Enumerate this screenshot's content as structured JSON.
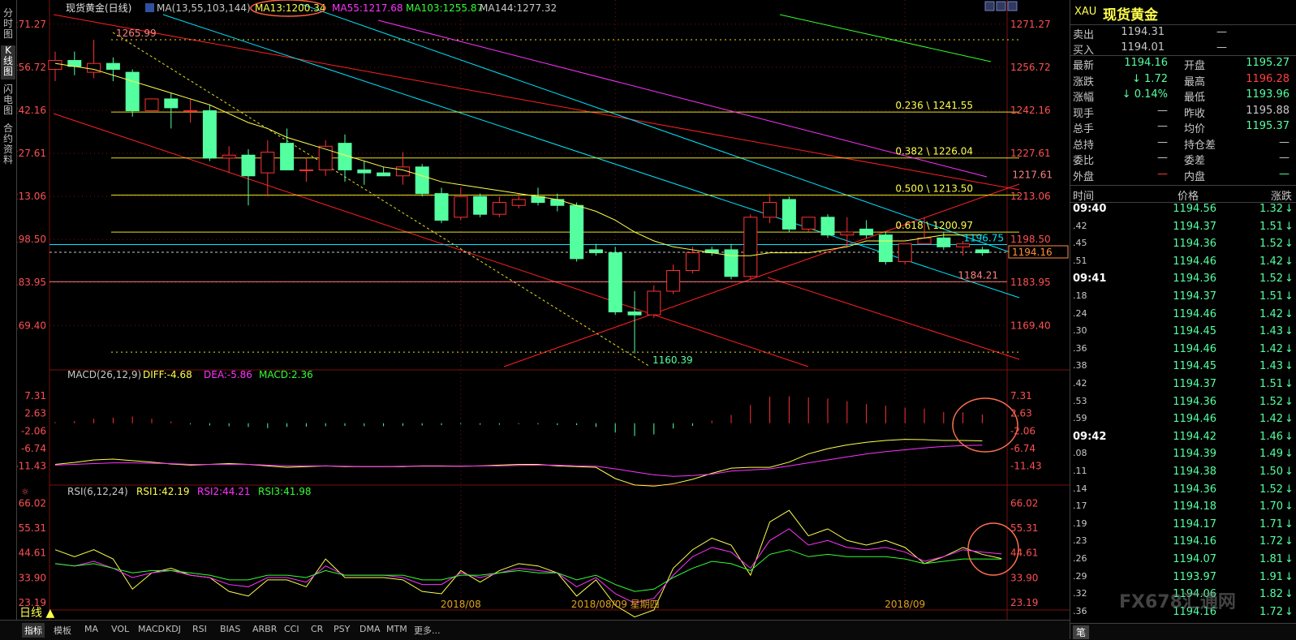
{
  "sidebar": {
    "tabs": [
      "分时图",
      "K线图",
      "闪电图",
      "合约资料"
    ]
  },
  "header": {
    "name": "现货黄金(日线)",
    "ma_label": "MA(13,55,103,144)",
    "ma13": "MA13:1200.34",
    "ma55": "MA55:1217.68",
    "ma103": "MA103:1255.87",
    "ma144": "MA144:1277.32"
  },
  "macd_header": {
    "label": "MACD(26,12,9)",
    "diff": "DIFF:-4.68",
    "dea": "DEA:-5.86",
    "macd": "MACD:2.36"
  },
  "rsi_header": {
    "label": "RSI(6,12,24)",
    "rsi1": "RSI1:42.19",
    "rsi2": "RSI2:44.21",
    "rsi3": "RSI3:41.98"
  },
  "colors": {
    "up": "#ff3232",
    "down": "#54ffa0",
    "ma13": "#ffff4c",
    "ma55": "#ff32ff",
    "ma103": "#32ff32",
    "ma144": "#c8c8c8",
    "cyan": "#00e5ff",
    "red_line": "#ff2020",
    "grid": "#7a1010",
    "axis": "#ff5050",
    "fib": "#e8e020"
  },
  "chart_data": [
    {
      "type": "candlestick",
      "title": "现货黄金(日线)",
      "price_axis_ticks": [
        "1271.27",
        "1256.72",
        "1242.16",
        "1227.61",
        "1213.06",
        "1198.50",
        "1183.95",
        "1169.40"
      ],
      "ylim": [
        1155.5,
        1274.5
      ],
      "x_labels": [
        {
          "i": 21,
          "label": "2018/08"
        },
        {
          "i": 29,
          "label": "2018/08/09 星期四"
        },
        {
          "i": 44,
          "label": "2018/09"
        }
      ],
      "candles": [
        {
          "o": 1256,
          "h": 1262,
          "l": 1252,
          "c": 1259
        },
        {
          "o": 1259,
          "h": 1262,
          "l": 1254,
          "c": 1257
        },
        {
          "o": 1255,
          "h": 1266,
          "l": 1253,
          "c": 1258
        },
        {
          "o": 1258,
          "h": 1260,
          "l": 1252,
          "c": 1256
        },
        {
          "o": 1255,
          "h": 1256,
          "l": 1240,
          "c": 1242
        },
        {
          "o": 1242,
          "h": 1246,
          "l": 1242,
          "c": 1246
        },
        {
          "o": 1246,
          "h": 1248,
          "l": 1236,
          "c": 1243
        },
        {
          "o": 1242,
          "h": 1246,
          "l": 1238,
          "c": 1242
        },
        {
          "o": 1242,
          "h": 1244,
          "l": 1225,
          "c": 1226
        },
        {
          "o": 1226,
          "h": 1230,
          "l": 1221,
          "c": 1227
        },
        {
          "o": 1227,
          "h": 1229,
          "l": 1210,
          "c": 1220
        },
        {
          "o": 1221,
          "h": 1232,
          "l": 1213,
          "c": 1228
        },
        {
          "o": 1231,
          "h": 1236,
          "l": 1223,
          "c": 1222
        },
        {
          "o": 1222,
          "h": 1226,
          "l": 1218,
          "c": 1222
        },
        {
          "o": 1222,
          "h": 1232,
          "l": 1220,
          "c": 1230
        },
        {
          "o": 1231,
          "h": 1234,
          "l": 1218,
          "c": 1222
        },
        {
          "o": 1222,
          "h": 1225,
          "l": 1217,
          "c": 1221
        },
        {
          "o": 1221,
          "h": 1223,
          "l": 1220,
          "c": 1220
        },
        {
          "o": 1220,
          "h": 1228,
          "l": 1217,
          "c": 1223
        },
        {
          "o": 1223,
          "h": 1224,
          "l": 1213,
          "c": 1214
        },
        {
          "o": 1214,
          "h": 1216,
          "l": 1204,
          "c": 1205
        },
        {
          "o": 1206,
          "h": 1216,
          "l": 1205,
          "c": 1213
        },
        {
          "o": 1213,
          "h": 1214,
          "l": 1206,
          "c": 1207
        },
        {
          "o": 1207,
          "h": 1213,
          "l": 1206,
          "c": 1211
        },
        {
          "o": 1210,
          "h": 1214,
          "l": 1209,
          "c": 1212
        },
        {
          "o": 1213,
          "h": 1216,
          "l": 1210,
          "c": 1211
        },
        {
          "o": 1212,
          "h": 1214,
          "l": 1208,
          "c": 1210
        },
        {
          "o": 1210,
          "h": 1211,
          "l": 1191,
          "c": 1192
        },
        {
          "o": 1195,
          "h": 1197,
          "l": 1193,
          "c": 1194
        },
        {
          "o": 1194,
          "h": 1196,
          "l": 1173,
          "c": 1174
        },
        {
          "o": 1174,
          "h": 1181,
          "l": 1160,
          "c": 1173
        },
        {
          "o": 1173,
          "h": 1183,
          "l": 1172,
          "c": 1181
        },
        {
          "o": 1181,
          "h": 1190,
          "l": 1180,
          "c": 1188
        },
        {
          "o": 1188,
          "h": 1196,
          "l": 1187,
          "c": 1194
        },
        {
          "o": 1195,
          "h": 1196,
          "l": 1193,
          "c": 1194
        },
        {
          "o": 1195,
          "h": 1197,
          "l": 1185,
          "c": 1186
        },
        {
          "o": 1186,
          "h": 1207,
          "l": 1185,
          "c": 1206
        },
        {
          "o": 1206,
          "h": 1214,
          "l": 1204,
          "c": 1211
        },
        {
          "o": 1212,
          "h": 1213,
          "l": 1201,
          "c": 1202
        },
        {
          "o": 1202,
          "h": 1206,
          "l": 1201,
          "c": 1206
        },
        {
          "o": 1206,
          "h": 1207,
          "l": 1199,
          "c": 1200
        },
        {
          "o": 1200,
          "h": 1206,
          "l": 1196,
          "c": 1201
        },
        {
          "o": 1202,
          "h": 1205,
          "l": 1199,
          "c": 1200
        },
        {
          "o": 1200,
          "h": 1201,
          "l": 1190,
          "c": 1191
        },
        {
          "o": 1191,
          "h": 1197,
          "l": 1190,
          "c": 1197
        },
        {
          "o": 1197,
          "h": 1206,
          "l": 1197,
          "c": 1199
        },
        {
          "o": 1199,
          "h": 1201,
          "l": 1195,
          "c": 1196
        },
        {
          "o": 1196,
          "h": 1198,
          "l": 1193,
          "c": 1197
        },
        {
          "o": 1195,
          "h": 1196,
          "l": 1193,
          "c": 1194
        }
      ],
      "ma13": [
        1258,
        1257,
        1256,
        1254,
        1252,
        1250,
        1248,
        1246,
        1244,
        1241,
        1238,
        1236,
        1233,
        1231,
        1229,
        1227,
        1225,
        1223,
        1222,
        1220,
        1218,
        1217,
        1216,
        1215,
        1214,
        1213,
        1212,
        1210,
        1208,
        1205,
        1201,
        1198,
        1196,
        1195,
        1194,
        1193,
        1193,
        1194,
        1194,
        1194,
        1195,
        1196,
        1198,
        1198,
        1198,
        1199,
        1200,
        1200,
        1200
      ],
      "ma55": [
        1236,
        1234,
        1232,
        1230,
        1228,
        1226,
        1224,
        1222,
        1220,
        1217.7
      ],
      "ma103": [
        1272,
        1266,
        1259,
        1255.9
      ],
      "level_labels": [
        {
          "price": 1265.99,
          "label": "1265.99"
        },
        {
          "price": 1241.55,
          "label": "0.236 \\ 1241.55"
        },
        {
          "price": 1226.04,
          "label": "0.382 \\ 1226.04"
        },
        {
          "price": 1213.5,
          "label": "0.500 \\ 1213.50"
        },
        {
          "price": 1200.97,
          "label": "0.618 \\ 1200.97"
        },
        {
          "price": 1196.75,
          "label": "1196.75"
        },
        {
          "price": 1184.21,
          "label": "1184.21"
        },
        {
          "price": 1160.39,
          "label": "1160.39"
        },
        {
          "price": 1217.61,
          "label": "1217.61"
        }
      ],
      "current_price": "1194.16"
    },
    {
      "type": "bar",
      "title": "MACD(26,12,9)",
      "axis_ticks": [
        "7.31",
        "2.63",
        "-2.06",
        "-6.74",
        "-11.43"
      ],
      "ylim": [
        -13.5,
        9.5
      ],
      "macd": [
        0.3,
        0.6,
        1.2,
        1.5,
        1.8,
        1.2,
        0.5,
        -0.3,
        -0.6,
        -0.8,
        -1.0,
        -1.3,
        -1.0,
        -0.9,
        -0.8,
        -0.7,
        -0.8,
        -0.8,
        -0.7,
        -0.6,
        -0.5,
        -0.3,
        -0.4,
        -0.4,
        -0.2,
        -0.3,
        -0.5,
        -0.5,
        -1.0,
        -2.5,
        -3.4,
        -3.0,
        -1.4,
        -0.7,
        0.7,
        2.2,
        4.9,
        7.1,
        7.2,
        6.9,
        6.6,
        5.9,
        5.1,
        4.7,
        4.2,
        3.9,
        3.0,
        2.9,
        2.36
      ],
      "diff": [
        -11.0,
        -10.5,
        -9.8,
        -9.6,
        -10.0,
        -10.4,
        -10.9,
        -11.2,
        -11.0,
        -10.8,
        -11.0,
        -11.4,
        -11.8,
        -11.6,
        -11.4,
        -11.6,
        -11.6,
        -11.6,
        -11.6,
        -11.4,
        -11.4,
        -11.5,
        -11.4,
        -11.2,
        -11.0,
        -11.0,
        -11.4,
        -11.6,
        -11.8,
        -14.8,
        -16.5,
        -16.8,
        -16.2,
        -15.0,
        -13.4,
        -12.0,
        -11.8,
        -11.8,
        -10.4,
        -8.2,
        -6.8,
        -5.8,
        -5.1,
        -4.6,
        -4.3,
        -4.4,
        -4.6,
        -4.6,
        -4.7
      ],
      "dea": [
        -11.2,
        -11.0,
        -10.8,
        -10.6,
        -10.6,
        -10.7,
        -10.8,
        -11.0,
        -11.0,
        -11.0,
        -11.0,
        -11.2,
        -11.4,
        -11.4,
        -11.4,
        -11.5,
        -11.6,
        -11.6,
        -11.5,
        -11.5,
        -11.5,
        -11.5,
        -11.4,
        -11.4,
        -11.3,
        -11.2,
        -11.2,
        -11.4,
        -11.5,
        -12.2,
        -13.0,
        -13.8,
        -14.2,
        -14.0,
        -13.6,
        -12.8,
        -12.5,
        -12.2,
        -11.4,
        -10.6,
        -9.8,
        -9.0,
        -8.2,
        -7.6,
        -7.1,
        -6.6,
        -6.2,
        -6.0,
        -5.86
      ]
    },
    {
      "type": "line",
      "title": "RSI(6,12,24)",
      "axis_ticks": [
        "66.02",
        "55.31",
        "44.61",
        "33.90",
        "23.19"
      ],
      "ylim": [
        20,
        69
      ],
      "rsi1": [
        46,
        43,
        46,
        42,
        29,
        36,
        38,
        35,
        34,
        28,
        26,
        33,
        33,
        30,
        42,
        34,
        34,
        34,
        33,
        28,
        27,
        37,
        32,
        37,
        40,
        39,
        36,
        26,
        33,
        22,
        17,
        20,
        38,
        46,
        51,
        48,
        35,
        58,
        63,
        52,
        55,
        50,
        48,
        50,
        47,
        40,
        43,
        47,
        44,
        42.19
      ],
      "rsi2": [
        40,
        39,
        41,
        38,
        34,
        36,
        37,
        35,
        34,
        31,
        30,
        34,
        34,
        32,
        39,
        35,
        35,
        35,
        34,
        31,
        31,
        36,
        34,
        36,
        38,
        37,
        36,
        30,
        34,
        27,
        23,
        25,
        35,
        43,
        47,
        45,
        38,
        50,
        55,
        48,
        50,
        47,
        46,
        47,
        45,
        41,
        43,
        46,
        45,
        44.21
      ],
      "rsi3": [
        40,
        39,
        40,
        38,
        36,
        37,
        37,
        36,
        35,
        33,
        33,
        35,
        35,
        34,
        37,
        35,
        35,
        35,
        35,
        33,
        33,
        35,
        35,
        36,
        37,
        36,
        36,
        33,
        35,
        31,
        28,
        29,
        34,
        38,
        41,
        40,
        37,
        44,
        46,
        43,
        44,
        43,
        43,
        43,
        42,
        40,
        41,
        42,
        42,
        41.98
      ]
    }
  ],
  "quote": {
    "code": "XAU",
    "name": "现货黄金",
    "rows": [
      {
        "label": "卖出",
        "value": "1194.31",
        "extra": "—"
      },
      {
        "label": "买入",
        "value": "1194.01",
        "extra": "—"
      }
    ],
    "grid": [
      {
        "l1": "最新",
        "v1": "1194.16",
        "l2": "开盘",
        "v2": "1195.27",
        "c1": "#54ffa0",
        "c2": "#54ffa0"
      },
      {
        "l1": "涨跌",
        "v1": "1.72",
        "l2": "最高",
        "v2": "1196.28",
        "c1": "#54ffa0",
        "c2": "#ff4040"
      },
      {
        "l1": "涨幅",
        "v1": "0.14%",
        "l2": "最低",
        "v2": "1193.96",
        "c1": "#54ffa0",
        "c2": "#54ffa0"
      },
      {
        "l1": "现手",
        "v1": "—",
        "l2": "昨收",
        "v2": "1195.88",
        "c1": "#c8c8c8",
        "c2": "#c8c8c8"
      },
      {
        "l1": "总手",
        "v1": "—",
        "l2": "均价",
        "v2": "1195.37",
        "c1": "#c8c8c8",
        "c2": "#54ffa0"
      },
      {
        "l1": "总持",
        "v1": "—",
        "l2": "持仓差",
        "v2": "—",
        "c1": "#c8c8c8",
        "c2": "#c8c8c8"
      },
      {
        "l1": "委比",
        "v1": "—",
        "l2": "委差",
        "v2": "—",
        "c1": "#c8c8c8",
        "c2": "#c8c8c8"
      },
      {
        "l1": "外盘",
        "v1": "—",
        "l2": "内盘",
        "v2": "—",
        "c1": "#ff4040",
        "c2": "#54ffa0"
      }
    ],
    "tick_header": {
      "time": "时间",
      "price": "价格",
      "change": "涨跌"
    },
    "ticks": [
      {
        "t": "09:40",
        "p": "1194.56",
        "c": "1.32"
      },
      {
        "t": ".42",
        "p": "1194.37",
        "c": "1.51"
      },
      {
        "t": ".45",
        "p": "1194.36",
        "c": "1.52"
      },
      {
        "t": ".51",
        "p": "1194.46",
        "c": "1.42"
      },
      {
        "t": "09:41",
        "p": "1194.36",
        "c": "1.52"
      },
      {
        "t": ".18",
        "p": "1194.37",
        "c": "1.51"
      },
      {
        "t": ".24",
        "p": "1194.46",
        "c": "1.42"
      },
      {
        "t": ".30",
        "p": "1194.45",
        "c": "1.43"
      },
      {
        "t": ".36",
        "p": "1194.46",
        "c": "1.42"
      },
      {
        "t": ".38",
        "p": "1194.45",
        "c": "1.43"
      },
      {
        "t": ".42",
        "p": "1194.37",
        "c": "1.51"
      },
      {
        "t": ".53",
        "p": "1194.36",
        "c": "1.52"
      },
      {
        "t": ".59",
        "p": "1194.46",
        "c": "1.42"
      },
      {
        "t": "09:42",
        "p": "1194.42",
        "c": "1.46"
      },
      {
        "t": ".08",
        "p": "1194.39",
        "c": "1.49"
      },
      {
        "t": ".11",
        "p": "1194.38",
        "c": "1.50"
      },
      {
        "t": ".14",
        "p": "1194.36",
        "c": "1.52"
      },
      {
        "t": ".17",
        "p": "1194.18",
        "c": "1.70"
      },
      {
        "t": ".19",
        "p": "1194.17",
        "c": "1.71"
      },
      {
        "t": ".23",
        "p": "1194.16",
        "c": "1.72"
      },
      {
        "t": ".26",
        "p": "1194.07",
        "c": "1.81"
      },
      {
        "t": ".29",
        "p": "1193.97",
        "c": "1.91"
      },
      {
        "t": ".32",
        "p": "1194.06",
        "c": "1.82"
      },
      {
        "t": ".36",
        "p": "1194.16",
        "c": "1.72"
      }
    ],
    "footer_tab": "笔",
    "watermark": "FX678汇通网"
  },
  "bottom": {
    "period": "日线",
    "tabs": [
      "指标",
      "模板",
      "MA",
      "VOL",
      "MACD",
      "KDJ",
      "RSI",
      "BIAS",
      "ARBR",
      "CCI",
      "CR",
      "PSY",
      "DMA",
      "MTM",
      "更多..."
    ]
  }
}
